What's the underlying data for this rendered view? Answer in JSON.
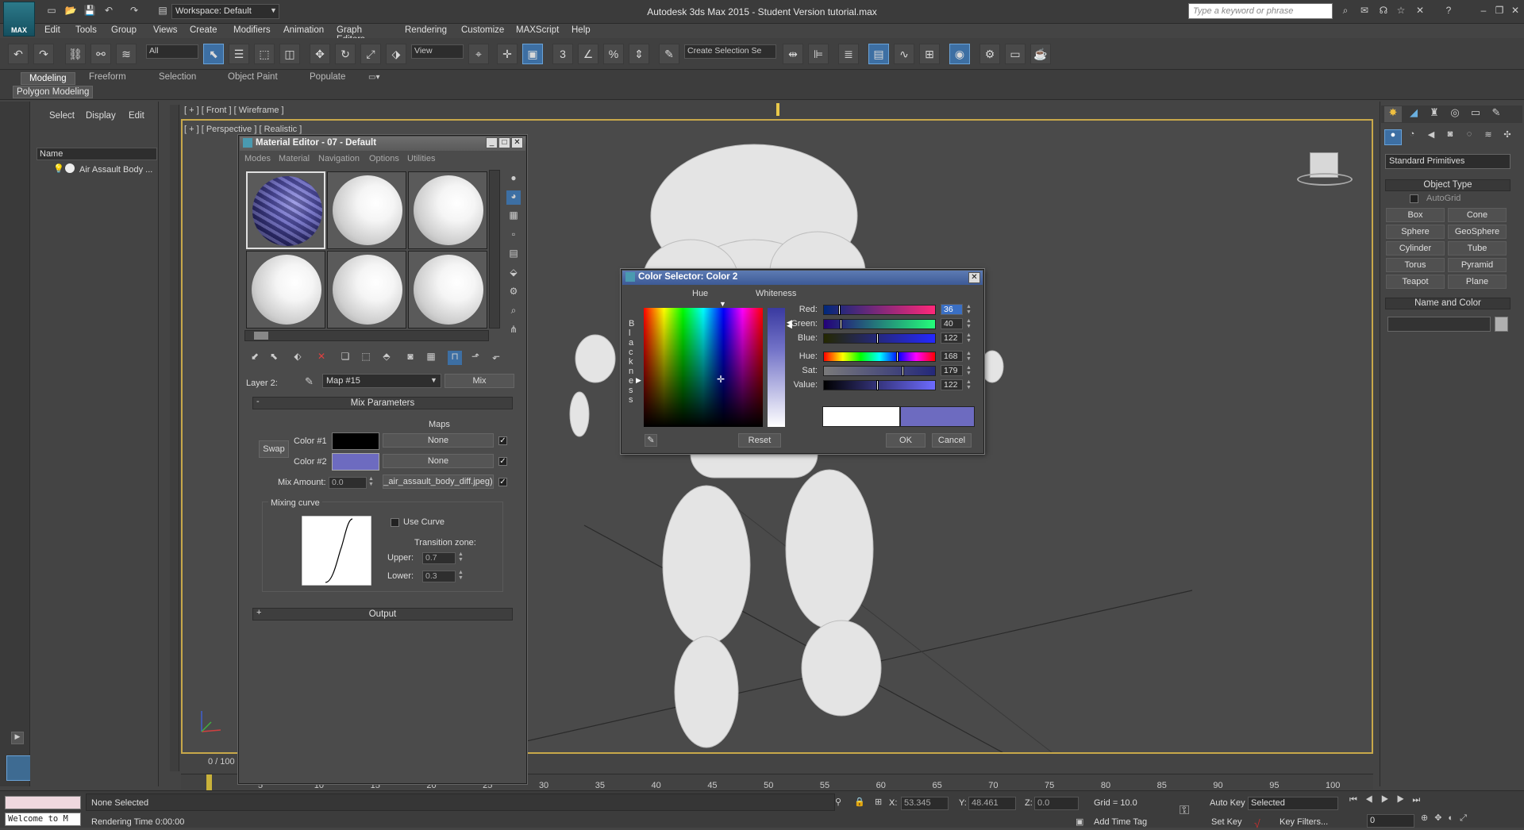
{
  "app": {
    "title": "Autodesk 3ds Max  2015  - Student Version    tutorial.max",
    "logo_label": "MAX",
    "workspace": "Workspace: Default",
    "search_placeholder": "Type a keyword or phrase"
  },
  "menu": [
    "Edit",
    "Tools",
    "Group",
    "Views",
    "Create",
    "Modifiers",
    "Animation",
    "Graph Editors",
    "Rendering",
    "Customize",
    "MAXScript",
    "Help"
  ],
  "toolbar": {
    "selection_filter": "All",
    "ref_coord": "View",
    "named_selection": "Create Selection Se"
  },
  "ribbon": {
    "tabs": [
      "Modeling",
      "Freeform",
      "Selection",
      "Object Paint",
      "Populate"
    ],
    "panel": "Polygon Modeling"
  },
  "scene_explorer": {
    "tabs": [
      "Select",
      "Display",
      "Edit"
    ],
    "column_header": "Name",
    "item": "Air Assault Body ..."
  },
  "viewports": {
    "front_label": "[ + ] [ Front ] [ Wireframe ]",
    "persp_label": "[ + ] [ Perspective ] [ Realistic ]",
    "frame_counter": "0 / 100"
  },
  "command_panel": {
    "category": "Standard Primitives",
    "object_type_title": "Object Type",
    "autogrid": "AutoGrid",
    "buttons": [
      "Box",
      "Cone",
      "Sphere",
      "GeoSphere",
      "Cylinder",
      "Tube",
      "Torus",
      "Pyramid",
      "Teapot",
      "Plane"
    ],
    "name_color_title": "Name and Color"
  },
  "material_editor": {
    "title": "Material Editor - 07 - Default",
    "menu": [
      "Modes",
      "Material",
      "Navigation",
      "Options",
      "Utilities"
    ],
    "layer_label": "Layer 2:",
    "map_name": "Map #15",
    "map_type": "Mix",
    "mix_params_title": "Mix Parameters",
    "maps_header": "Maps",
    "swap": "Swap",
    "color1_label": "Color #1",
    "color2_label": "Color #2",
    "color1": "#000000",
    "color2": "#6d6bc0",
    "map1": "None",
    "map2": "None",
    "mix_amount_label": "Mix Amount:",
    "mix_amount": "0.0",
    "mix_map": "_air_assault_body_diff.jpeg)",
    "mixing_curve_title": "Mixing curve",
    "use_curve": "Use Curve",
    "transition_zone": "Transition zone:",
    "upper_label": "Upper:",
    "upper": "0.7",
    "lower_label": "Lower:",
    "lower": "0.3",
    "output_title": "Output",
    "collapse_sign": "-",
    "expand_sign": "+"
  },
  "color_selector": {
    "title": "Color Selector: Color 2",
    "hue_label": "Hue",
    "whiteness_label": "Whiteness",
    "blackness_label": "Blackness",
    "red_label": "Red:",
    "red": "36",
    "green_label": "Green:",
    "green": "40",
    "blue_label": "Blue:",
    "blue": "122",
    "hue2_label": "Hue:",
    "hue": "168",
    "sat_label": "Sat:",
    "sat": "179",
    "value_label": "Value:",
    "value": "122",
    "reset": "Reset",
    "ok": "OK",
    "cancel": "Cancel",
    "old_color": "#ffffff",
    "new_color": "#6d6bc0"
  },
  "timeline": {
    "ticks": [
      "5",
      "10",
      "15",
      "20",
      "25",
      "30",
      "35",
      "40",
      "45",
      "50",
      "55",
      "60",
      "65",
      "70",
      "75",
      "80",
      "85",
      "90",
      "95",
      "100"
    ]
  },
  "status": {
    "selection": "None Selected",
    "rendering_time": "Rendering Time  0:00:00",
    "welcome": "Welcome to M",
    "x_label": "X:",
    "x": "53.345",
    "y_label": "Y:",
    "y": "48.461",
    "z_label": "Z:",
    "z": "0.0",
    "grid": "Grid = 10.0",
    "add_time_tag": "Add Time Tag",
    "auto_key": "Auto Key",
    "set_key": "Set Key",
    "key_mode": "Selected",
    "key_filters": "Key Filters...",
    "current_frame": "0"
  }
}
